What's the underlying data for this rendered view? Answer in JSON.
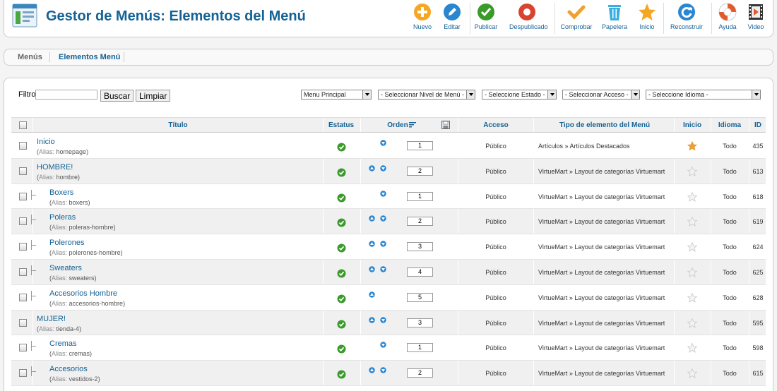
{
  "header": {
    "title": "Gestor de Menús: Elementos del Menú",
    "toolbar": [
      {
        "key": "new",
        "label": "Nuevo",
        "icon": "plus-icon",
        "color": "#f5a623"
      },
      {
        "key": "edit",
        "label": "Editar",
        "icon": "pencil-icon",
        "color": "#2a86d0"
      },
      {
        "key": "publish",
        "label": "Publicar",
        "icon": "check-icon",
        "color": "#3a9a2a"
      },
      {
        "key": "unpublish",
        "label": "Despublicado",
        "icon": "circle-stop-icon",
        "color": "#d7452f"
      },
      {
        "key": "checkin",
        "label": "Comprobar",
        "icon": "checkmark-icon",
        "color": "#f0a030"
      },
      {
        "key": "trash",
        "label": "Papelera",
        "icon": "trash-icon",
        "color": "#3aaee0"
      },
      {
        "key": "home",
        "label": "Inicio",
        "icon": "star-icon",
        "color": "#f5a623"
      },
      {
        "key": "rebuild",
        "label": "Reconstruir",
        "icon": "refresh-icon",
        "color": "#2a86d0"
      },
      {
        "key": "help",
        "label": "Ayuda",
        "icon": "lifebuoy-icon",
        "color": "#e25a2c"
      },
      {
        "key": "video",
        "label": "Video",
        "icon": "film-icon",
        "color": "#333333"
      }
    ]
  },
  "submenu": {
    "items": [
      {
        "label": "Menús",
        "active": false
      },
      {
        "label": "Elementos Menú",
        "active": true
      }
    ]
  },
  "filter": {
    "label": "Filtro:",
    "value": "",
    "search_button": "Buscar",
    "clear_button": "Limpiar",
    "selects": [
      {
        "name": "menu-select",
        "value": "Menu Principal"
      },
      {
        "name": "level-select",
        "value": "- Seleccionar Nivel de Menú -"
      },
      {
        "name": "state-select",
        "value": "- Seleccione Estado -"
      },
      {
        "name": "access-select",
        "value": "- Seleccionar Acceso -"
      },
      {
        "name": "language-select",
        "value": "- Seleccione Idioma -"
      }
    ]
  },
  "table": {
    "headers": {
      "title": "Título",
      "status": "Estatus",
      "order": "Orden",
      "access": "Acceso",
      "type": "Tipo de elemento del Menú",
      "home": "Inicio",
      "language": "Idioma",
      "id": "ID"
    },
    "alias_label": "Alias:",
    "rows": [
      {
        "title": "Inicio",
        "alias": "homepage",
        "level": 1,
        "up": false,
        "down": true,
        "order": "1",
        "access": "Público",
        "type": "Artículos » Artículos Destacados",
        "home": true,
        "language": "Todo",
        "id": "435"
      },
      {
        "title": "HOMBRE!",
        "alias": "hombre",
        "level": 1,
        "up": true,
        "down": true,
        "order": "2",
        "access": "Público",
        "type": "VirtueMart » Layout de categorías Virtuemart",
        "home": false,
        "language": "Todo",
        "id": "613"
      },
      {
        "title": "Boxers",
        "alias": "boxers",
        "level": 2,
        "up": false,
        "down": true,
        "order": "1",
        "access": "Público",
        "type": "VirtueMart » Layout de categorías Virtuemart",
        "home": false,
        "language": "Todo",
        "id": "618"
      },
      {
        "title": "Poleras",
        "alias": "poleras-hombre",
        "level": 2,
        "up": true,
        "down": true,
        "order": "2",
        "access": "Público",
        "type": "VirtueMart » Layout de categorías Virtuemart",
        "home": false,
        "language": "Todo",
        "id": "619"
      },
      {
        "title": "Polerones",
        "alias": "polerones-hombre",
        "level": 2,
        "up": true,
        "down": true,
        "order": "3",
        "access": "Público",
        "type": "VirtueMart » Layout de categorías Virtuemart",
        "home": false,
        "language": "Todo",
        "id": "624"
      },
      {
        "title": "Sweaters",
        "alias": "sweaters",
        "level": 2,
        "up": true,
        "down": true,
        "order": "4",
        "access": "Público",
        "type": "VirtueMart » Layout de categorías Virtuemart",
        "home": false,
        "language": "Todo",
        "id": "625"
      },
      {
        "title": "Accesorios Hombre",
        "alias": "accesorios-hombre",
        "level": 2,
        "up": true,
        "down": false,
        "order": "5",
        "access": "Público",
        "type": "VirtueMart » Layout de categorías Virtuemart",
        "home": false,
        "language": "Todo",
        "id": "628"
      },
      {
        "title": "MUJER!",
        "alias": "tienda-4",
        "level": 1,
        "up": true,
        "down": true,
        "order": "3",
        "access": "Público",
        "type": "VirtueMart » Layout de categorías Virtuemart",
        "home": false,
        "language": "Todo",
        "id": "595"
      },
      {
        "title": "Cremas",
        "alias": "cremas",
        "level": 2,
        "up": false,
        "down": true,
        "order": "1",
        "access": "Público",
        "type": "VirtueMart » Layout de categorías Virtuemart",
        "home": false,
        "language": "Todo",
        "id": "598"
      },
      {
        "title": "Accesorios",
        "alias": "vestidos-2",
        "level": 2,
        "up": true,
        "down": true,
        "order": "2",
        "access": "Público",
        "type": "VirtueMart » Layout de categorías Virtuemart",
        "home": false,
        "language": "Todo",
        "id": "615"
      }
    ]
  }
}
